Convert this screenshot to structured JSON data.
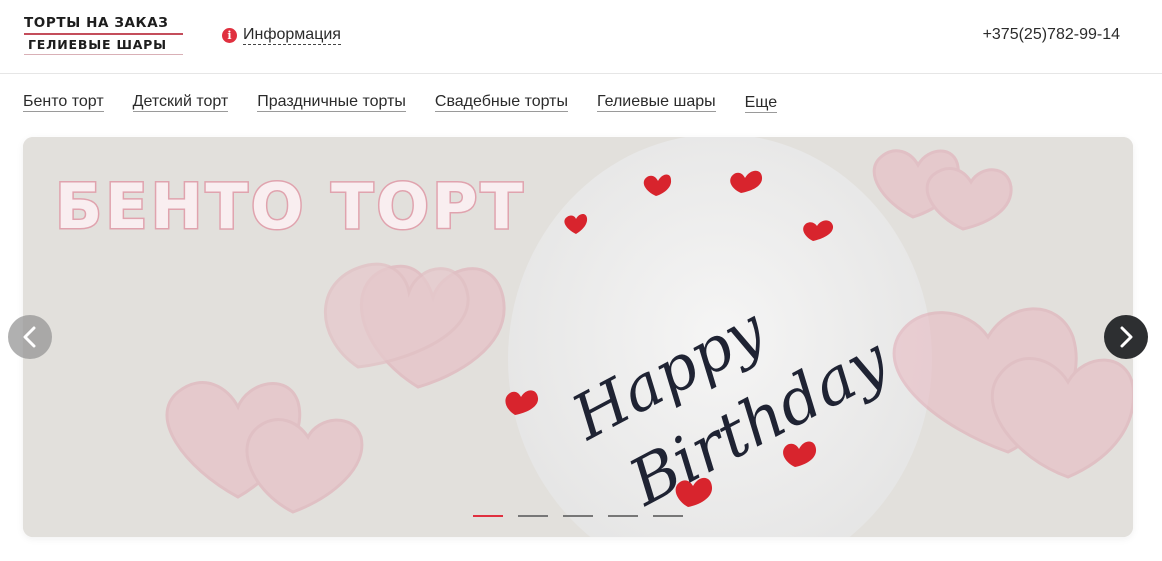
{
  "header": {
    "logo_top": "ТОРТЫ НА ЗАКАЗ",
    "logo_bottom": "ГЕЛИЕВЫЕ ШАРЫ",
    "info_label": "Информация",
    "info_icon": "info-icon",
    "phone": "+375(25)782-99-14"
  },
  "nav": {
    "items": [
      "Бенто торт",
      "Детский торт",
      "Праздничные торты",
      "Свадебные торты",
      "Гелиевые шары",
      "Еще"
    ]
  },
  "slider": {
    "title": "БЕНТО ТОРТ",
    "cake_text_line1": "Happy",
    "cake_text_line2": "Birthday",
    "prev_icon": "chevron-left-icon",
    "next_icon": "chevron-right-icon",
    "slide_count": 5,
    "active_slide": 1
  },
  "colors": {
    "accent": "#e0303f",
    "title_pink": "#e9b5bf",
    "banner_bg": "#e2e0dc",
    "next_arrow_bg": "#2d2f31"
  }
}
